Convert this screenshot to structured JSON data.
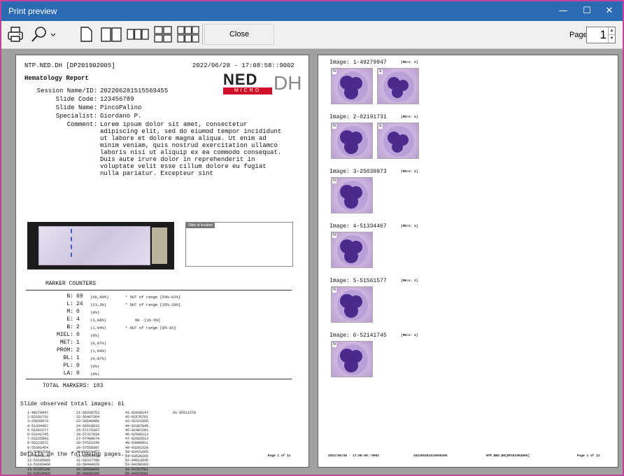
{
  "window": {
    "title": "Print preview"
  },
  "window_controls": {
    "minimize": "—",
    "maximize": "☐",
    "close": "✕"
  },
  "toolbar": {
    "close_label": "Close",
    "page_label": "Page",
    "page_value": "1"
  },
  "page1": {
    "header_left": "NTP.NED.DH  [DP201902005]",
    "header_right": "2022/06/28 - 17:08:58::9002",
    "report_title": "Hematology Report",
    "logo": {
      "ned": "NED",
      "micro": "MICRO",
      "dh": "DH"
    },
    "fields": [
      {
        "label": "Session Name/ID:",
        "value": "202206281515569455"
      },
      {
        "label": "Slide Code:",
        "value": "123456789"
      },
      {
        "label": "Slide Name:",
        "value": "PincoPalino"
      },
      {
        "label": "Specialist:",
        "value": "Giordano P."
      },
      {
        "label": "Comment:",
        "value": "Lorem ipsum dolor sit amet, consectetur adipiscing elit, sed do eiumod tempor incididunt ut labore et dolore magna aliqua. Ut enim ad minim veniam, quis nostrud exercitation ullamco laboris nisi ut aliquip ex ea commodo consequat. Duis aute irure dolor in reprehenderit in voluptate velit esse cillum dolore eu fugiat nulla pariatur. Excepteur sint"
      }
    ],
    "location_tag": "Slide id location",
    "marker_title": "MARKER COUNTERS",
    "markers": [
      {
        "name": "N:",
        "count": "69",
        "pct": "(66,99%)",
        "note": "* OUT of range [54%-62%]"
      },
      {
        "name": "L:",
        "count": "24",
        "pct": "(23,3%)",
        "note": "* OUT of range [25%-33%]"
      },
      {
        "name": "M:",
        "count": "0",
        "pct": "(0%)",
        "note": ""
      },
      {
        "name": "E:",
        "count": "4",
        "pct": "(3,88%)",
        "note": "OK -[1%-5%]"
      },
      {
        "name": "B:",
        "count": "2",
        "pct": "(1,94%)",
        "note": "* OUT of range [0%-1%]"
      },
      {
        "name": "MIEL:",
        "count": "0",
        "pct": "(0%)",
        "note": ""
      },
      {
        "name": "MET:",
        "count": "1",
        "pct": "(0,97%)",
        "note": ""
      },
      {
        "name": "PROM:",
        "count": "2",
        "pct": "(1,94%)",
        "note": ""
      },
      {
        "name": "BL:",
        "count": "1",
        "pct": "(0,97%)",
        "note": ""
      },
      {
        "name": "PL:",
        "count": "0",
        "pct": "(0%)",
        "note": ""
      },
      {
        "name": "LA:",
        "count": "0",
        "pct": "(0%)",
        "note": ""
      }
    ],
    "total": "TOTAL MARKERS: 103",
    "observed": "Slide observed total images: 61",
    "id_columns": [
      [
        "1-49279947",
        "2-02191731",
        "3-25039973",
        "4-51334467",
        "5-51561577",
        "6-52141745",
        "7-53225993",
        "8-55223072",
        "9-55391454",
        "10-52587664",
        "11-53058242",
        "12-53166665",
        "13-53293460",
        "14-53350336",
        "15-53529425",
        "16-54246790",
        "17-54260248",
        "18-54444705",
        "19-55043817",
        "20-55220224"
      ],
      [
        "21-56338753",
        "22-56487364",
        "23-56546486",
        "24-56918933",
        "25-57175307",
        "26-57327934",
        "27-57409674",
        "28-57521249",
        "29-57558397",
        "30-58021457",
        "31-58165558",
        "32-58327780",
        "33-58404629",
        "34-58580809",
        "35-59095206",
        "36-59256971",
        "37-59308239",
        "38-59460793",
        "39-60182447",
        "40-61372042"
      ],
      [
        "41-92039147",
        "42-92176761",
        "43-92321555",
        "44-92387045",
        "45-92487281",
        "46-92560113",
        "47-92665513",
        "48-93080911",
        "49-93281528",
        "50-93421665",
        "51-93536265",
        "52-94012035",
        "53-94208303",
        "54-94287501",
        "55-94426581",
        "56-94492294",
        "57-94580590",
        "58-95035262",
        "59-95111500",
        "60-95191841"
      ],
      [
        "61-95511578"
      ]
    ],
    "details": "Details on the following pages...",
    "page_num": "Page 1 of 11"
  },
  "page2": {
    "images": [
      {
        "title": "Image: 1-49279947",
        "mkrs": "[Mkrs: 2]",
        "cells": [
          "N",
          "E"
        ]
      },
      {
        "title": "Image: 2-02191731",
        "mkrs": "[Mkrs: 2]",
        "cells": [
          "N",
          "E"
        ]
      },
      {
        "title": "Image: 3-25039973",
        "mkrs": "[Mkrs: 1]",
        "cells": [
          "N"
        ]
      },
      {
        "title": "Image: 4-51334467",
        "mkrs": "[Mkrs: 1]",
        "cells": [
          "N"
        ]
      },
      {
        "title": "Image: 5-51561577",
        "mkrs": "[Mkrs: 1]",
        "cells": [
          "N"
        ]
      },
      {
        "title": "Image: 6-52141745",
        "mkrs": "[Mkrs: 1]",
        "cells": [
          "N"
        ]
      }
    ],
    "footer": {
      "timestamp": "2022/06/28 - 17:08:58::9002",
      "session": "202206281515569455",
      "ntp": "NTP.NED.DH[DP201902005]",
      "page_num": "Page 1 of 11"
    }
  }
}
